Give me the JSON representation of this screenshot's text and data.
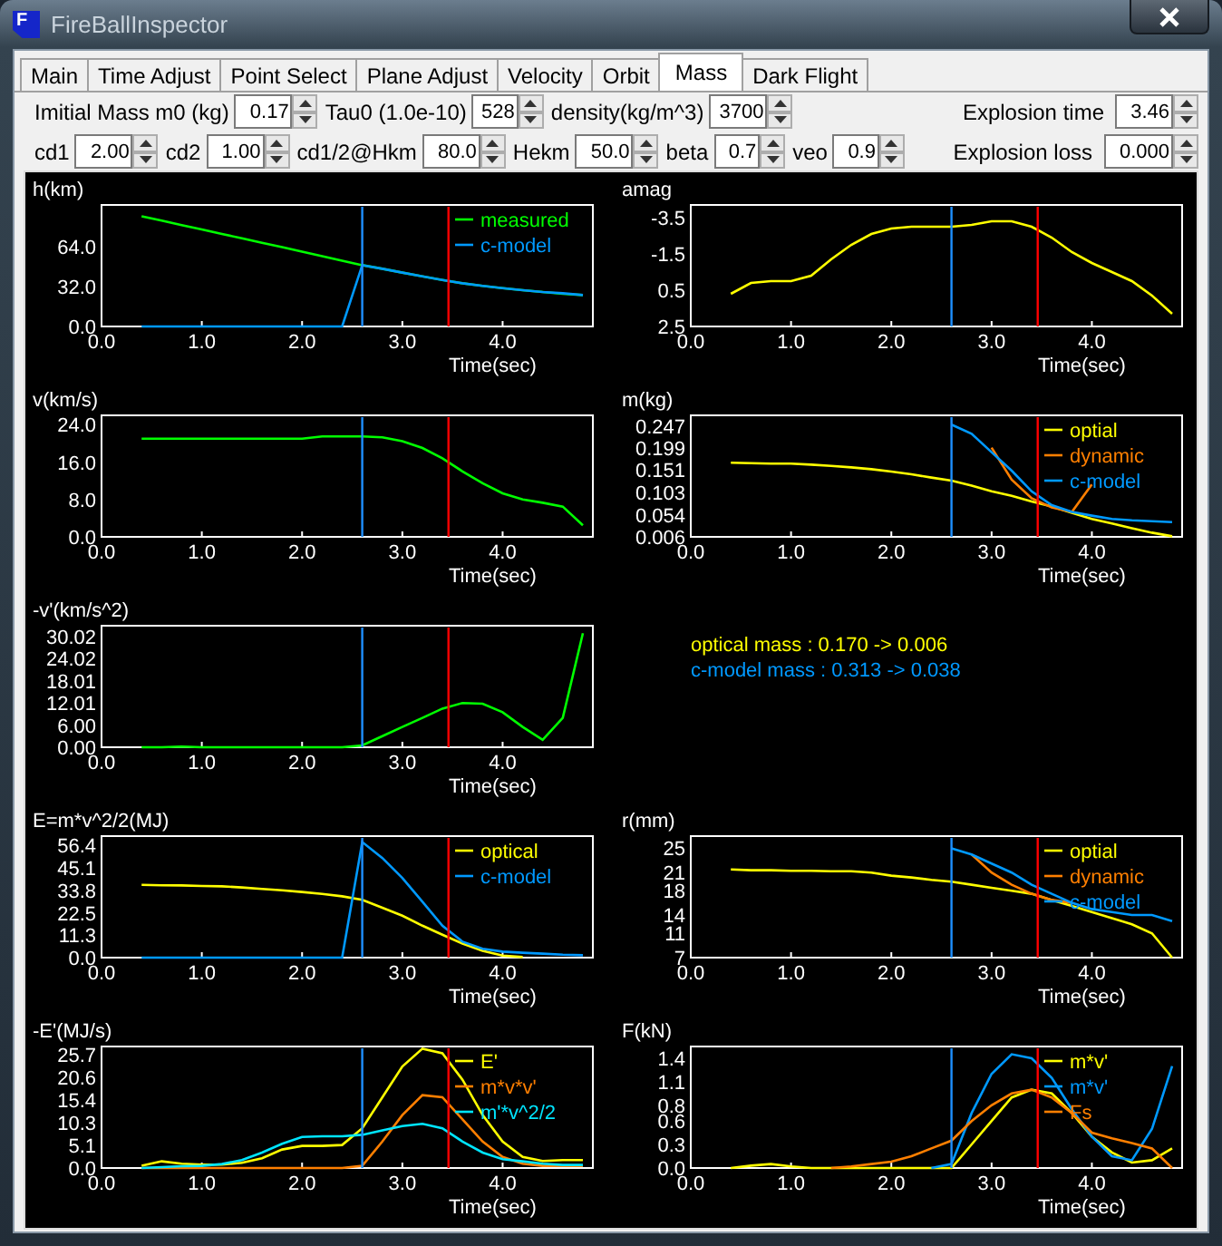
{
  "window": {
    "title": "FireBallInspector",
    "icon_letter": "F"
  },
  "tabs": [
    {
      "label": "Main",
      "selected": false
    },
    {
      "label": "Time Adjust",
      "selected": false
    },
    {
      "label": "Point Select",
      "selected": false
    },
    {
      "label": "Plane Adjust",
      "selected": false
    },
    {
      "label": "Velocity",
      "selected": false
    },
    {
      "label": "Orbit",
      "selected": false
    },
    {
      "label": "Mass",
      "selected": true
    },
    {
      "label": "Dark Flight",
      "selected": false
    }
  ],
  "parameters": [
    [
      {
        "label": "Imitial Mass m0 (kg)",
        "value": "0.17"
      },
      {
        "label": "Tau0 (1.0e-10)",
        "value": "528"
      },
      {
        "label": "density(kg/m^3)",
        "value": "3700"
      },
      {
        "label": "Explosion time",
        "value": "3.46"
      }
    ],
    [
      {
        "label": "cd1",
        "value": "2.00"
      },
      {
        "label": "cd2",
        "value": "1.00"
      },
      {
        "label": "cd1/2@Hkm",
        "value": "80.0"
      },
      {
        "label": "Hekm",
        "value": "50.0"
      },
      {
        "label": "beta",
        "value": "0.7"
      },
      {
        "label": "veo",
        "value": "0.9"
      },
      {
        "label": "Explosion loss",
        "value": "0.000"
      }
    ]
  ],
  "plot_panel": {
    "columns": [
      [
        {
          "kind": "chart",
          "chart_data": {
            "type": "line",
            "title": "h(km)",
            "xlabel": "Time(sec)",
            "legend": true,
            "xlim": [
              0,
              4.9
            ],
            "ylim": [
              0,
              97
            ],
            "x": [
              0.4,
              0.6,
              0.8,
              1.0,
              1.2,
              1.4,
              1.6,
              1.8,
              2.0,
              2.2,
              2.4,
              2.6,
              2.8,
              3.0,
              3.2,
              3.4,
              3.6,
              3.8,
              4.0,
              4.2,
              4.4,
              4.6,
              4.8
            ],
            "xticks": [
              {
                "value": 0,
                "label": "0.0"
              },
              {
                "value": 1,
                "label": "1.0"
              },
              {
                "value": 2,
                "label": "2.0"
              },
              {
                "value": 3,
                "label": "3.0"
              },
              {
                "value": 4,
                "label": "4.0"
              }
            ],
            "yticks": [
              {
                "value": 0,
                "label": "0.0"
              },
              {
                "value": 32,
                "label": "32.0"
              },
              {
                "value": 64,
                "label": "64.0"
              }
            ],
            "ref_lines": [
              {
                "axis": "x",
                "value": 2.6,
                "color": "#1e90ff"
              },
              {
                "axis": "x",
                "value": 3.46,
                "color": "#ff0000"
              }
            ],
            "series": [
              {
                "name": "measured",
                "color": "#00ff00",
                "values": [
                  88,
                  84.5,
                  81,
                  77.4,
                  73.9,
                  70.3,
                  66.8,
                  63.3,
                  59.7,
                  56.2,
                  52.6,
                  49,
                  46,
                  43,
                  40,
                  37,
                  34.5,
                  32.5,
                  30.5,
                  29,
                  27.5,
                  26,
                  25
                ]
              },
              {
                "name": "c-model",
                "color": "#0099ff",
                "values": [
                  0,
                  0,
                  0,
                  0,
                  0,
                  0,
                  0,
                  0,
                  0,
                  0,
                  0,
                  49,
                  46,
                  43,
                  40,
                  37,
                  34.5,
                  32.5,
                  30.5,
                  29,
                  27.5,
                  26.5,
                  25
                ]
              }
            ]
          }
        },
        {
          "kind": "chart",
          "chart_data": {
            "type": "line",
            "title": "v(km/s)",
            "xlabel": "Time(sec)",
            "legend": false,
            "xlim": [
              0,
              4.9
            ],
            "ylim": [
              0,
              26
            ],
            "x": [
              0.4,
              0.6,
              0.8,
              1.0,
              1.2,
              1.4,
              1.6,
              1.8,
              2.0,
              2.2,
              2.4,
              2.6,
              2.8,
              3.0,
              3.2,
              3.4,
              3.6,
              3.8,
              4.0,
              4.2,
              4.4,
              4.6,
              4.8
            ],
            "xticks": [
              {
                "value": 0,
                "label": "0.0"
              },
              {
                "value": 1,
                "label": "1.0"
              },
              {
                "value": 2,
                "label": "2.0"
              },
              {
                "value": 3,
                "label": "3.0"
              },
              {
                "value": 4,
                "label": "4.0"
              }
            ],
            "yticks": [
              {
                "value": 0,
                "label": "0.0"
              },
              {
                "value": 8,
                "label": "8.0"
              },
              {
                "value": 16,
                "label": "16.0"
              },
              {
                "value": 24,
                "label": "24.0"
              }
            ],
            "ref_lines": [
              {
                "axis": "x",
                "value": 2.6,
                "color": "#1e90ff"
              },
              {
                "axis": "x",
                "value": 3.46,
                "color": "#ff0000"
              }
            ],
            "series": [
              {
                "color": "#00ff00",
                "values": [
                  21,
                  21,
                  21,
                  21,
                  21,
                  21,
                  21,
                  21,
                  21,
                  21.5,
                  21.5,
                  21.5,
                  21.3,
                  20.5,
                  19,
                  16.8,
                  14,
                  11.5,
                  9.3,
                  8,
                  7.3,
                  6.5,
                  2.5
                ]
              }
            ]
          }
        },
        {
          "kind": "chart",
          "chart_data": {
            "type": "line",
            "title": "-v'(km/s^2)",
            "xlabel": "Time(sec)",
            "legend": false,
            "xlim": [
              0,
              4.9
            ],
            "ylim": [
              0,
              33
            ],
            "x": [
              0.4,
              0.6,
              0.8,
              1.0,
              1.2,
              1.4,
              1.6,
              1.8,
              2.0,
              2.2,
              2.4,
              2.6,
              2.8,
              3.0,
              3.2,
              3.4,
              3.6,
              3.8,
              4.0,
              4.2,
              4.4,
              4.6,
              4.8
            ],
            "xticks": [
              {
                "value": 0,
                "label": "0.0"
              },
              {
                "value": 1,
                "label": "1.0"
              },
              {
                "value": 2,
                "label": "2.0"
              },
              {
                "value": 3,
                "label": "3.0"
              },
              {
                "value": 4,
                "label": "4.0"
              }
            ],
            "yticks": [
              {
                "value": 0,
                "label": "0.00"
              },
              {
                "value": 6,
                "label": "6.00"
              },
              {
                "value": 12.01,
                "label": "12.01"
              },
              {
                "value": 18.01,
                "label": "18.01"
              },
              {
                "value": 24.02,
                "label": "24.02"
              },
              {
                "value": 30.02,
                "label": "30.02"
              }
            ],
            "ref_lines": [
              {
                "axis": "x",
                "value": 2.6,
                "color": "#1e90ff"
              },
              {
                "axis": "x",
                "value": 3.46,
                "color": "#ff0000"
              }
            ],
            "series": [
              {
                "color": "#00ff00",
                "values": [
                  0,
                  0,
                  0.2,
                  0,
                  0,
                  0,
                  0,
                  0,
                  0,
                  0,
                  0,
                  0.5,
                  3,
                  5.5,
                  8,
                  10.5,
                  12,
                  11.8,
                  9.5,
                  5.5,
                  2,
                  8,
                  31
                ]
              }
            ]
          }
        },
        {
          "kind": "chart",
          "chart_data": {
            "type": "line",
            "title": "E=m*v^2/2(MJ)",
            "xlabel": "Time(sec)",
            "legend": true,
            "xlim": [
              0,
              4.9
            ],
            "ylim": [
              0,
              61
            ],
            "x": [
              0.4,
              0.6,
              0.8,
              1.0,
              1.2,
              1.4,
              1.6,
              1.8,
              2.0,
              2.2,
              2.4,
              2.6,
              2.8,
              3.0,
              3.2,
              3.4,
              3.6,
              3.8,
              4.0,
              4.2,
              4.4,
              4.6,
              4.8
            ],
            "xticks": [
              {
                "value": 0,
                "label": "0.0"
              },
              {
                "value": 1,
                "label": "1.0"
              },
              {
                "value": 2,
                "label": "2.0"
              },
              {
                "value": 3,
                "label": "3.0"
              },
              {
                "value": 4,
                "label": "4.0"
              }
            ],
            "yticks": [
              {
                "value": 0,
                "label": "0.0"
              },
              {
                "value": 11.3,
                "label": "11.3"
              },
              {
                "value": 22.5,
                "label": "22.5"
              },
              {
                "value": 33.8,
                "label": "33.8"
              },
              {
                "value": 45.1,
                "label": "45.1"
              },
              {
                "value": 56.4,
                "label": "56.4"
              }
            ],
            "ref_lines": [
              {
                "axis": "x",
                "value": 2.6,
                "color": "#1e90ff"
              },
              {
                "axis": "x",
                "value": 3.46,
                "color": "#ff0000"
              }
            ],
            "series": [
              {
                "name": "optical",
                "color": "#ffff00",
                "values": [
                  36.5,
                  36.3,
                  36.2,
                  36,
                  35.8,
                  35.2,
                  34.5,
                  33.8,
                  33,
                  32,
                  30.8,
                  29,
                  25,
                  21,
                  16,
                  11.5,
                  7,
                  3.5,
                  1,
                  0.3,
                  null,
                  null,
                  null
                ]
              },
              {
                "name": "c-model",
                "color": "#0099ff",
                "values": [
                  0,
                  0,
                  0,
                  0,
                  0,
                  0,
                  0,
                  0,
                  0,
                  0,
                  0,
                  58,
                  50,
                  40,
                  28,
                  16,
                  8,
                  4.5,
                  3,
                  2.5,
                  2,
                  1.5,
                  1.2
                ]
              }
            ]
          }
        },
        {
          "kind": "chart",
          "chart_data": {
            "type": "line",
            "title": "-E'(MJ/s)",
            "xlabel": "Time(sec)",
            "legend": true,
            "xlim": [
              0,
              4.9
            ],
            "ylim": [
              0,
              27.5
            ],
            "x": [
              0.4,
              0.6,
              0.8,
              1.0,
              1.2,
              1.4,
              1.6,
              1.8,
              2.0,
              2.2,
              2.4,
              2.6,
              2.8,
              3.0,
              3.2,
              3.4,
              3.6,
              3.8,
              4.0,
              4.2,
              4.4,
              4.6,
              4.8
            ],
            "xticks": [
              {
                "value": 0,
                "label": "0.0"
              },
              {
                "value": 1,
                "label": "1.0"
              },
              {
                "value": 2,
                "label": "2.0"
              },
              {
                "value": 3,
                "label": "3.0"
              },
              {
                "value": 4,
                "label": "4.0"
              }
            ],
            "yticks": [
              {
                "value": 0,
                "label": "0.0"
              },
              {
                "value": 5.1,
                "label": "5.1"
              },
              {
                "value": 10.3,
                "label": "10.3"
              },
              {
                "value": 15.4,
                "label": "15.4"
              },
              {
                "value": 20.6,
                "label": "20.6"
              },
              {
                "value": 25.7,
                "label": "25.7"
              }
            ],
            "ref_lines": [
              {
                "axis": "x",
                "value": 2.6,
                "color": "#1e90ff"
              },
              {
                "axis": "x",
                "value": 3.46,
                "color": "#ff0000"
              }
            ],
            "series": [
              {
                "name": "E'",
                "color": "#ffff00",
                "values": [
                  0.5,
                  1.5,
                  1,
                  0.8,
                  0.8,
                  1.2,
                  2.2,
                  4.2,
                  5,
                  5,
                  5.2,
                  9,
                  16,
                  23,
                  27,
                  26,
                  20,
                  12,
                  6,
                  2.5,
                  1.6,
                  1.8,
                  1.8
                ]
              },
              {
                "name": "m*v*v'",
                "color": "#ff7f00",
                "values": [
                  0,
                  0,
                  0,
                  0,
                  0,
                  0,
                  0,
                  0,
                  0,
                  0,
                  0,
                  0.5,
                  6,
                  12,
                  16.5,
                  16,
                  11,
                  6,
                  2.5,
                  1,
                  0.5,
                  0.5,
                  0.5
                ]
              },
              {
                "name": "m'*v^2/2",
                "color": "#00e5ff",
                "values": [
                  0,
                  0.2,
                  0.4,
                  0.5,
                  0.9,
                  1.8,
                  3.5,
                  5.5,
                  7,
                  7.2,
                  7.2,
                  7.5,
                  8.5,
                  9.5,
                  10,
                  9,
                  6,
                  3.5,
                  2,
                  1.5,
                  1,
                  0.7,
                  0.7
                ]
              }
            ]
          }
        }
      ],
      [
        {
          "kind": "chart",
          "chart_data": {
            "type": "line",
            "title": "amag",
            "xlabel": "Time(sec)",
            "legend": false,
            "xlim": [
              0,
              4.9
            ],
            "ylim": [
              2.5,
              -4.2
            ],
            "x": [
              0.4,
              0.6,
              0.8,
              1.0,
              1.2,
              1.4,
              1.6,
              1.8,
              2.0,
              2.2,
              2.4,
              2.6,
              2.8,
              3.0,
              3.2,
              3.4,
              3.6,
              3.8,
              4.0,
              4.2,
              4.4,
              4.6,
              4.8
            ],
            "xticks": [
              {
                "value": 0,
                "label": "0.0"
              },
              {
                "value": 1,
                "label": "1.0"
              },
              {
                "value": 2,
                "label": "2.0"
              },
              {
                "value": 3,
                "label": "3.0"
              },
              {
                "value": 4,
                "label": "4.0"
              }
            ],
            "yticks": [
              {
                "value": 2.5,
                "label": "2.5"
              },
              {
                "value": 0.5,
                "label": "0.5"
              },
              {
                "value": -1.5,
                "label": "-1.5"
              },
              {
                "value": -3.5,
                "label": "-3.5"
              }
            ],
            "ref_lines": [
              {
                "axis": "x",
                "value": 2.6,
                "color": "#1e90ff"
              },
              {
                "axis": "x",
                "value": 3.46,
                "color": "#ff0000"
              }
            ],
            "series": [
              {
                "color": "#ffff00",
                "values": [
                  0.7,
                  0.1,
                  0,
                  0,
                  -0.3,
                  -1.2,
                  -2,
                  -2.6,
                  -2.9,
                  -3,
                  -3,
                  -3,
                  -3.1,
                  -3.3,
                  -3.3,
                  -3,
                  -2.4,
                  -1.6,
                  -1,
                  -0.5,
                  0,
                  0.8,
                  1.8
                ]
              }
            ]
          }
        },
        {
          "kind": "chart",
          "chart_data": {
            "type": "line",
            "title": "m(kg)",
            "xlabel": "Time(sec)",
            "legend": true,
            "xlim": [
              0,
              4.9
            ],
            "ylim": [
              0.006,
              0.27
            ],
            "x": [
              0.4,
              0.6,
              0.8,
              1.0,
              1.2,
              1.4,
              1.6,
              1.8,
              2.0,
              2.2,
              2.4,
              2.6,
              2.8,
              3.0,
              3.2,
              3.4,
              3.6,
              3.8,
              4.0,
              4.2,
              4.4,
              4.6,
              4.8
            ],
            "xticks": [
              {
                "value": 0,
                "label": "0.0"
              },
              {
                "value": 1,
                "label": "1.0"
              },
              {
                "value": 2,
                "label": "2.0"
              },
              {
                "value": 3,
                "label": "3.0"
              },
              {
                "value": 4,
                "label": "4.0"
              }
            ],
            "yticks": [
              {
                "value": 0.006,
                "label": "0.006"
              },
              {
                "value": 0.054,
                "label": "0.054"
              },
              {
                "value": 0.103,
                "label": "0.103"
              },
              {
                "value": 0.151,
                "label": "0.151"
              },
              {
                "value": 0.199,
                "label": "0.199"
              },
              {
                "value": 0.247,
                "label": "0.247"
              }
            ],
            "ref_lines": [
              {
                "axis": "x",
                "value": 2.6,
                "color": "#1e90ff"
              },
              {
                "axis": "x",
                "value": 3.46,
                "color": "#ff0000"
              }
            ],
            "series": [
              {
                "name": "optial",
                "color": "#ffff00",
                "values": [
                  0.167,
                  0.166,
                  0.165,
                  0.165,
                  0.163,
                  0.16,
                  0.157,
                  0.153,
                  0.148,
                  0.142,
                  0.135,
                  0.128,
                  0.117,
                  0.105,
                  0.095,
                  0.083,
                  0.072,
                  0.058,
                  0.045,
                  0.035,
                  0.025,
                  0.015,
                  0.007
                ]
              },
              {
                "name": "dynamic",
                "color": "#ff7f00",
                "values": [
                  null,
                  null,
                  null,
                  null,
                  null,
                  null,
                  null,
                  null,
                  null,
                  null,
                  null,
                  null,
                  null,
                  0.2,
                  0.13,
                  0.09,
                  0.07,
                  0.06,
                  0.12,
                  null,
                  null,
                  null,
                  null
                ]
              },
              {
                "name": "c-model",
                "color": "#0099ff",
                "values": [
                  null,
                  null,
                  null,
                  null,
                  null,
                  null,
                  null,
                  null,
                  null,
                  null,
                  null,
                  0.25,
                  0.23,
                  0.19,
                  0.15,
                  0.105,
                  0.075,
                  0.06,
                  0.052,
                  0.045,
                  0.042,
                  0.04,
                  0.038
                ]
              }
            ]
          }
        },
        {
          "kind": "summary",
          "lines": [
            {
              "text": "optical mass : 0.170 -> 0.006",
              "color": "#ffff00"
            },
            {
              "text": "c-model mass : 0.313 -> 0.038",
              "color": "#0099ff"
            }
          ]
        },
        {
          "kind": "chart",
          "chart_data": {
            "type": "line",
            "title": "r(mm)",
            "xlabel": "Time(sec)",
            "legend": true,
            "xlim": [
              0,
              4.9
            ],
            "ylim": [
              7,
              27
            ],
            "x": [
              0.4,
              0.6,
              0.8,
              1.0,
              1.2,
              1.4,
              1.6,
              1.8,
              2.0,
              2.2,
              2.4,
              2.6,
              2.8,
              3.0,
              3.2,
              3.4,
              3.6,
              3.8,
              4.0,
              4.2,
              4.4,
              4.6,
              4.8
            ],
            "xticks": [
              {
                "value": 0,
                "label": "0.0"
              },
              {
                "value": 1,
                "label": "1.0"
              },
              {
                "value": 2,
                "label": "2.0"
              },
              {
                "value": 3,
                "label": "3.0"
              },
              {
                "value": 4,
                "label": "4.0"
              }
            ],
            "yticks": [
              {
                "value": 7,
                "label": "7"
              },
              {
                "value": 11,
                "label": "11"
              },
              {
                "value": 14,
                "label": "14"
              },
              {
                "value": 18,
                "label": "18"
              },
              {
                "value": 21,
                "label": "21"
              },
              {
                "value": 25,
                "label": "25"
              }
            ],
            "ref_lines": [
              {
                "axis": "x",
                "value": 2.6,
                "color": "#1e90ff"
              },
              {
                "axis": "x",
                "value": 3.46,
                "color": "#ff0000"
              }
            ],
            "series": [
              {
                "name": "optial",
                "color": "#ffff00",
                "values": [
                  21.5,
                  21.4,
                  21.4,
                  21.3,
                  21.3,
                  21.2,
                  21.2,
                  21,
                  20.5,
                  20.2,
                  19.8,
                  19.5,
                  19,
                  18.5,
                  18,
                  17.5,
                  16.5,
                  15.5,
                  14.5,
                  13.5,
                  12.5,
                  11,
                  7
                ]
              },
              {
                "name": "dynamic",
                "color": "#ff7f00",
                "values": [
                  null,
                  null,
                  null,
                  null,
                  null,
                  null,
                  null,
                  null,
                  null,
                  null,
                  null,
                  null,
                  24,
                  21,
                  19,
                  17.5,
                  16.5,
                  16,
                  null,
                  null,
                  null,
                  null,
                  null
                ]
              },
              {
                "name": "c-model",
                "color": "#0099ff",
                "values": [
                  null,
                  null,
                  null,
                  null,
                  null,
                  null,
                  null,
                  null,
                  null,
                  null,
                  null,
                  25,
                  24,
                  22.5,
                  21,
                  19,
                  17.5,
                  16,
                  15,
                  14.5,
                  14,
                  14,
                  13
                ]
              }
            ]
          }
        },
        {
          "kind": "chart",
          "chart_data": {
            "type": "line",
            "title": "F(kN)",
            "xlabel": "Time(sec)",
            "legend": true,
            "xlim": [
              0,
              4.9
            ],
            "ylim": [
              0,
              1.55
            ],
            "x": [
              0.4,
              0.6,
              0.8,
              1.0,
              1.2,
              1.4,
              1.6,
              1.8,
              2.0,
              2.2,
              2.4,
              2.6,
              2.8,
              3.0,
              3.2,
              3.4,
              3.6,
              3.8,
              4.0,
              4.2,
              4.4,
              4.6,
              4.8
            ],
            "xticks": [
              {
                "value": 0,
                "label": "0.0"
              },
              {
                "value": 1,
                "label": "1.0"
              },
              {
                "value": 2,
                "label": "2.0"
              },
              {
                "value": 3,
                "label": "3.0"
              },
              {
                "value": 4,
                "label": "4.0"
              }
            ],
            "yticks": [
              {
                "value": 0,
                "label": "0.0"
              },
              {
                "value": 0.3,
                "label": "0.3"
              },
              {
                "value": 0.6,
                "label": "0.6"
              },
              {
                "value": 0.8,
                "label": "0.8"
              },
              {
                "value": 1.1,
                "label": "1.1"
              },
              {
                "value": 1.4,
                "label": "1.4"
              }
            ],
            "ref_lines": [
              {
                "axis": "x",
                "value": 2.6,
                "color": "#1e90ff"
              },
              {
                "axis": "x",
                "value": 3.46,
                "color": "#ff0000"
              }
            ],
            "series": [
              {
                "name": "m*v'",
                "color": "#ffff00",
                "values": [
                  0,
                  0.03,
                  0.05,
                  0.02,
                  0,
                  0,
                  0,
                  0,
                  0,
                  0,
                  0,
                  0,
                  0.3,
                  0.6,
                  0.9,
                  1,
                  0.95,
                  0.7,
                  0.4,
                  0.2,
                  0.07,
                  0.1,
                  0.25
                ]
              },
              {
                "name": "m*v'",
                "color": "#0099ff",
                "values": [
                  null,
                  null,
                  null,
                  null,
                  null,
                  null,
                  null,
                  null,
                  null,
                  null,
                  0,
                  0.05,
                  0.7,
                  1.2,
                  1.45,
                  1.4,
                  1.15,
                  0.75,
                  0.4,
                  0.15,
                  0.1,
                  0.5,
                  1.3
                ]
              },
              {
                "name": "Fs",
                "color": "#ff7f00",
                "values": [
                  null,
                  null,
                  null,
                  null,
                  null,
                  0,
                  0.02,
                  0.05,
                  0.08,
                  0.15,
                  0.25,
                  0.35,
                  0.6,
                  0.8,
                  0.95,
                  1,
                  0.9,
                  0.7,
                  0.45,
                  0.38,
                  0.32,
                  0.25,
                  0
                ]
              }
            ]
          }
        }
      ]
    ]
  }
}
